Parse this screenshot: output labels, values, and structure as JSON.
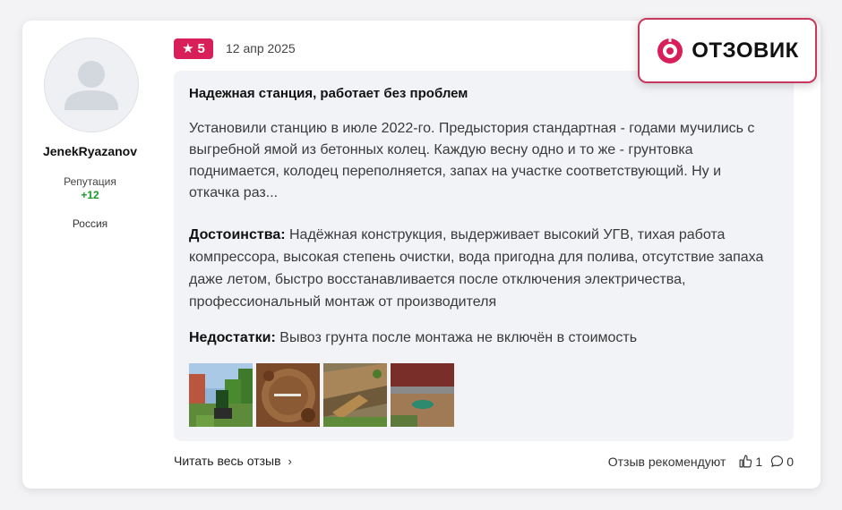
{
  "user": {
    "name": "JenekRyazanov",
    "reputation_label": "Репутация",
    "reputation_value": "+12",
    "country": "Россия"
  },
  "review": {
    "rating": "5",
    "date": "12 апр 2025",
    "title": "Надежная станция, работает без проблем",
    "body": "Установили станцию в июле 2022-го. Предыстория стандартная - годами мучились с выгребной ямой из бетонных колец. Каждую весну одно и то же - грунтовка поднимается, колодец переполняется, запах на участке соответствующий. Ну и откачка раз...",
    "pros_label": "Достоинства:",
    "pros_text": "Надёжная конструкция, выдерживает высокий УГВ, тихая работа компрессора, высокая степень очистки, вода пригодна для полива, отсутствие запаха даже летом, быстро восстанавливается после отключения электричества, профессиональный монтаж от производителя",
    "cons_label": "Недостатки:",
    "cons_text": "Вывоз грунта после монтажа не включён в стоимость",
    "photos": [
      "photo-1",
      "photo-2",
      "photo-3",
      "photo-4"
    ]
  },
  "footer": {
    "read_more": "Читать весь отзыв",
    "recommend_label": "Отзыв рекомендуют",
    "likes": "1",
    "comments": "0"
  },
  "logo": {
    "text": "ОТЗОВИК",
    "color": "#d81f5a"
  },
  "colors": {
    "accent": "#d81f5a",
    "reputation": "#1a9a2a",
    "content_bg": "#f2f3f6"
  }
}
